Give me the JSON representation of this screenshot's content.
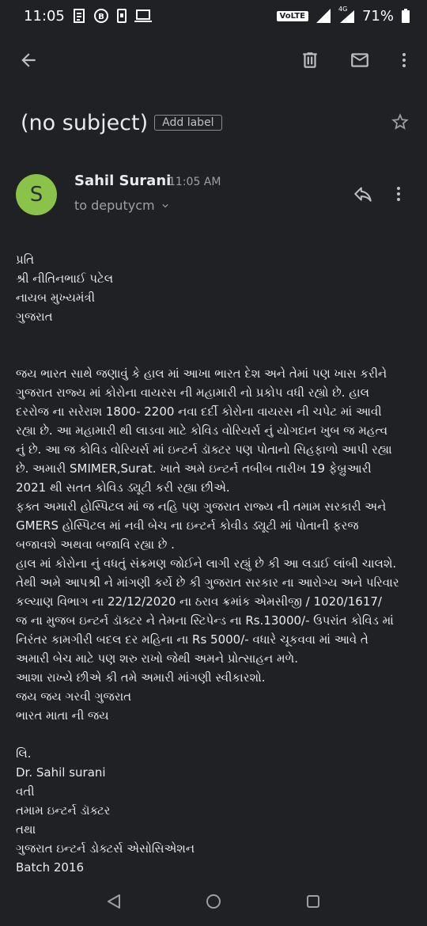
{
  "status_bar": {
    "time": "11:05",
    "volte": "VoLTE",
    "network": "4G",
    "battery": "71%"
  },
  "toolbar": {
    "back_icon": "arrow-left-icon",
    "delete_icon": "trash-icon",
    "mark_unread_icon": "envelope-icon",
    "more_icon": "more-vertical-icon"
  },
  "email": {
    "subject": "(no subject)",
    "add_label": "Add label",
    "sender_initial": "S",
    "sender_name": "Sahil Surani",
    "time": "11:05 AM",
    "recipient": "to deputycm",
    "body_header": [
      "પ્રતિ",
      "શ્રી નીતિનભાઈ પટેલ",
      "નાયબ મુખ્યમંત્રી",
      "ગુજરાત"
    ],
    "body_lines": [
      "જય ભારત સાથે જણાવું કે હાલ માં આખા ભારત દેશ અને તેમાં પણ ખાસ કરીને",
      "ગુજરાત રાજ્ય માં કોરોના વાયરસ ની મહામારી નો પ્રકોપ વધી રહ્યો છે. હાલ",
      "દરરોજ ના સરેરાશ 1800- 2200 નવા દર્દી કોરોના વાયરસ ની ચપેટ માં આવી",
      "રહ્યા છે. આ મહામારી થી લાડવા માટે કોવિડ વોરિયર્સ નું યોગદાન ખુબ જ મહત્વ",
      "નું છે.  આ જ કોવિડ વોરિયર્સ માં ઇન્ટર્ન ડૉક્ટર પણ પોતાનો સિહફાળો આપી રહ્યા",
      "છે.  અમારી SMIMER,Surat. ખાતે અમે ઇન્ટર્ન તબીબ તારીખ 19 ફેબ્રુઆરી",
      "2021 થી સતત કોવિડ  ડ્યૂટી કરી રહ્યા છીએ.",
      "ફક્ત અમારી હોસ્પિટલ માં જ નહિ પણ ગુજરાત રાજ્ય ની તમામ સરકારી અને",
      "GMERS હોસ્પિટલ માં નવી બેચ ના ઇન્ટર્ન કોવીડ ડ્યૂટી માં પોતાની ફરજ",
      "બજાવશે અથવા બજાવિ રહ્યા છે .",
      "હાલ માં કોરોના નું વધતું સંક્રમણ જોઈને લાગી રહ્યું છે કી આ લડાઈ લાંબી ચાલશે.",
      "તેથી અમે આપશ્રી ને માંગણી કર્યે છે કી ગુજરાત સરકાર ના આરોગ્ય અને પરિવાર",
      "કલ્યાણ વિભાગ ના 22/12/2020 ના ઠરાવ ક્રમાંક એમસીજી / 1020/1617/",
      "જ ના મુજબ ઇન્ટર્ન ડૉક્ટર ને તેમના સ્ટિપેન્ડ ના Rs.13000/- ઉપરાંત કોવિડ  માં",
      "નિરંતર કામગીરી બદલ દર મહિના ના Rs 5000/- વધારે ચૂકવવા માં આવે તે",
      "અમારી બેચ માટે પણ શરુ રાખો જેથી અમને પ્રોત્સાહન મળે.",
      "આશા રાખ્યે છીએ કી તમે અમારી માંગણી સ્વીકારશો.",
      "જય જય ગરવી ગુજરાત",
      "ભારત માતા ની જય"
    ],
    "signature_lines": [
      "લિ.",
      "Dr. Sahil surani",
      "વતી",
      "તમામ ઇન્ટર્ન ડૉક્ટર",
      "તથા",
      "ગુજરાત ઇન્ટર્ન ડોક્ટર્સ એસોસિએશન",
      "Batch 2016"
    ]
  },
  "colors": {
    "background": "#202124",
    "avatar": "#8bc34a",
    "text": "#e8eaed",
    "muted": "#9aa0a6"
  },
  "nav_bar": {
    "back_icon": "nav-back-triangle-icon",
    "home_icon": "nav-home-circle-icon",
    "recents_icon": "nav-recents-square-icon"
  }
}
